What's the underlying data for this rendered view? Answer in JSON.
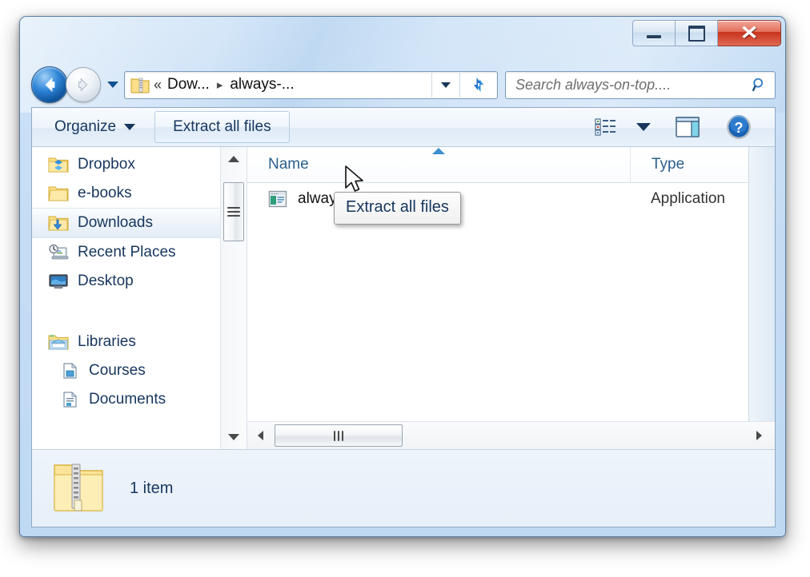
{
  "window": {
    "frame_color": "#bfd9f3",
    "caption_buttons": [
      {
        "name": "minimize",
        "label": "Minimize"
      },
      {
        "name": "maximize",
        "label": "Maximize"
      },
      {
        "name": "close",
        "label": "Close",
        "color": "#c9321d"
      }
    ]
  },
  "navigation": {
    "back_label": "Back",
    "forward_label": "Forward",
    "history_dropdown_label": "Recent pages",
    "refresh_label": "Refresh"
  },
  "address_bar": {
    "folder_icon": "zip-folder-icon",
    "overflow": "«",
    "crumbs": [
      "Dow...",
      "always-..."
    ],
    "separator": "▸",
    "dropdown_label": "Previous locations"
  },
  "search": {
    "placeholder": "Search always-on-top....",
    "icon": "search-icon"
  },
  "toolbar": {
    "organize_label": "Organize",
    "extract_label": "Extract all files",
    "view_options_label": "Change your view",
    "preview_pane_label": "Show the preview pane",
    "help_label": "Get help"
  },
  "tooltip": {
    "text": "Extract all files"
  },
  "sidebar": {
    "items": [
      {
        "label": "Dropbox",
        "icon": "dropbox-folder-icon",
        "selected": false,
        "indent": false
      },
      {
        "label": "e-books",
        "icon": "folder-icon",
        "selected": false,
        "indent": false
      },
      {
        "label": "Downloads",
        "icon": "downloads-folder-icon",
        "selected": true,
        "indent": false
      },
      {
        "label": "Recent Places",
        "icon": "recent-places-icon",
        "selected": false,
        "indent": false
      },
      {
        "label": "Desktop",
        "icon": "desktop-icon",
        "selected": false,
        "indent": false
      }
    ],
    "group": [
      {
        "label": "Libraries",
        "icon": "libraries-icon",
        "selected": false,
        "indent": false
      },
      {
        "label": "Courses",
        "icon": "library-icon",
        "selected": false,
        "indent": true
      },
      {
        "label": "Documents",
        "icon": "documents-library-icon",
        "selected": false,
        "indent": true
      }
    ]
  },
  "file_list": {
    "columns": [
      {
        "key": "name",
        "label": "Name",
        "sorted": true,
        "sort_direction": "asc"
      },
      {
        "key": "type",
        "label": "Type",
        "sorted": false,
        "sort_direction": ""
      }
    ],
    "rows": [
      {
        "name": "always-on-top.exe",
        "type": "Application",
        "icon": "application-icon"
      }
    ]
  },
  "status_bar": {
    "icon": "zip-folder-large-icon",
    "item_count_text": "1 item"
  },
  "scrollbars": {
    "vertical_up_label": "Scroll up",
    "vertical_down_label": "Scroll down",
    "horizontal_left_label": "Scroll left",
    "horizontal_right_label": "Scroll right"
  }
}
